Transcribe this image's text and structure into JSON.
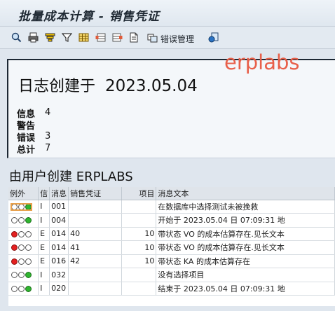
{
  "window": {
    "title": "批量成本计算 - 销售凭证"
  },
  "toolbar": {
    "error_mgmt_label": "错误管理"
  },
  "watermark": {
    "text": "erplabs"
  },
  "log_header": {
    "title": "日志创建于",
    "date": "2023.05.04",
    "stats": [
      {
        "label": "信息",
        "value": "4"
      },
      {
        "label": "警告",
        "value": ""
      },
      {
        "label": "错误",
        "value": "3"
      },
      {
        "label": "总计",
        "value": "7"
      }
    ]
  },
  "section": {
    "title": "由用户创建 ERPLABS"
  },
  "table": {
    "columns": [
      "例外",
      "信",
      "消息",
      "销售凭证",
      "项目",
      "消息文本"
    ],
    "rows": [
      {
        "status": "green",
        "type": "I",
        "msg": "001",
        "doc": "",
        "item": "",
        "text": "在数据库中选择测试未被挽救"
      },
      {
        "status": "green",
        "type": "I",
        "msg": "004",
        "doc": "",
        "item": "",
        "text": "开始于 2023.05.04 日 07:09:31 地"
      },
      {
        "status": "red",
        "type": "E",
        "msg": "014",
        "doc": "40",
        "item": "10",
        "text": "带状态 VO 的成本估算存在.见长文本"
      },
      {
        "status": "red",
        "type": "E",
        "msg": "014",
        "doc": "41",
        "item": "10",
        "text": "带状态 VO 的成本估算存在.见长文本"
      },
      {
        "status": "red",
        "type": "E",
        "msg": "016",
        "doc": "42",
        "item": "10",
        "text": "带状态 KA 的成本估算存在"
      },
      {
        "status": "green",
        "type": "I",
        "msg": "032",
        "doc": "",
        "item": "",
        "text": "没有选择项目"
      },
      {
        "status": "green",
        "type": "I",
        "msg": "020",
        "doc": "",
        "item": "",
        "text": "结束于 2023.05.04 日 07:09:31 地"
      }
    ]
  },
  "colors": {
    "accent_red": "#e42020",
    "accent_green": "#2fb52f",
    "watermark": "#e8604a"
  }
}
